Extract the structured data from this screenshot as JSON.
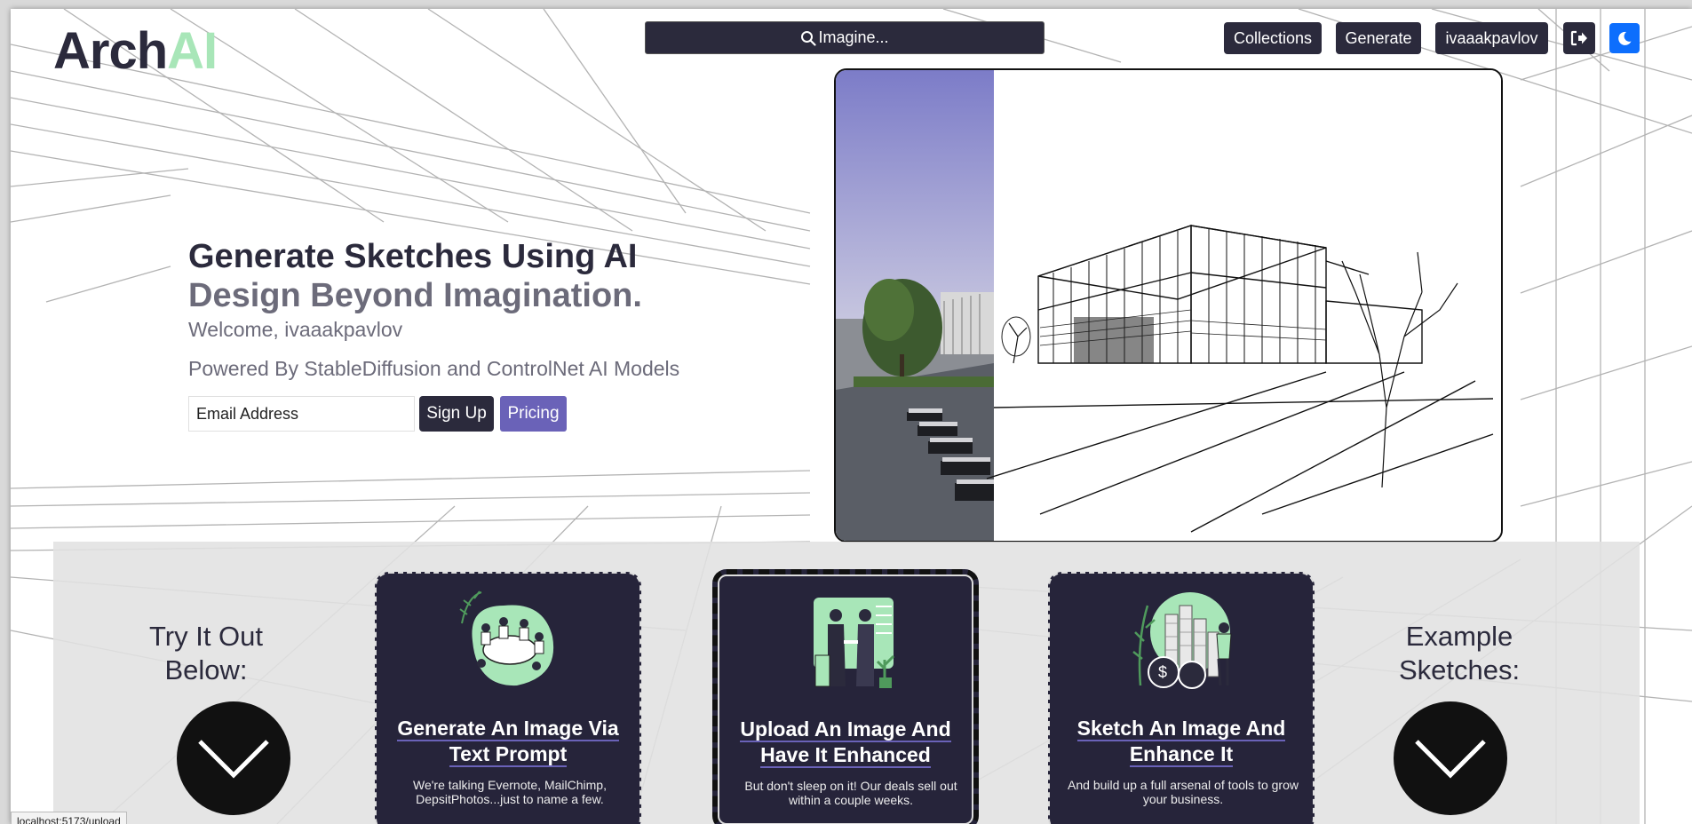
{
  "logo": {
    "part1": "Arch",
    "part2": "AI"
  },
  "header": {
    "search_label": "Imagine...",
    "nav": {
      "collections": "Collections",
      "generate": "Generate",
      "user": "ivaaakpavlov"
    }
  },
  "hero": {
    "title": "Generate Sketches Using AI",
    "subtitle": "Design Beyond Imagination.",
    "welcome": "Welcome, ivaaakpavlov",
    "powered": "Powered By StableDiffusion and ControlNet AI Models",
    "email_placeholder": "Email Address",
    "signup_label": "Sign Up",
    "pricing_label": "Pricing"
  },
  "lower": {
    "try_heading": "Try It Out Below:",
    "example_heading": "Example Sketches:",
    "cards": [
      {
        "title": "Generate An Image Via Text Prompt",
        "description": "We're talking Evernote, MailChimp, DepsitPhotos...just to name a few."
      },
      {
        "title": "Upload An Image And Have It Enhanced",
        "description": "But don't sleep on it! Our deals sell out within a couple weeks."
      },
      {
        "title": "Sketch An Image And Enhance It",
        "description": "And build up a full arsenal of tools to grow your business."
      }
    ]
  },
  "status_url": "localhost:5173/upload",
  "colors": {
    "primary_dark": "#2b2a3c",
    "accent_green": "#a8e6b8",
    "accent_purple": "#6a62b8",
    "toggle_blue": "#0d6efd"
  },
  "icons": [
    "search-icon",
    "logout-icon",
    "moon-icon",
    "chevron-down-icon"
  ]
}
